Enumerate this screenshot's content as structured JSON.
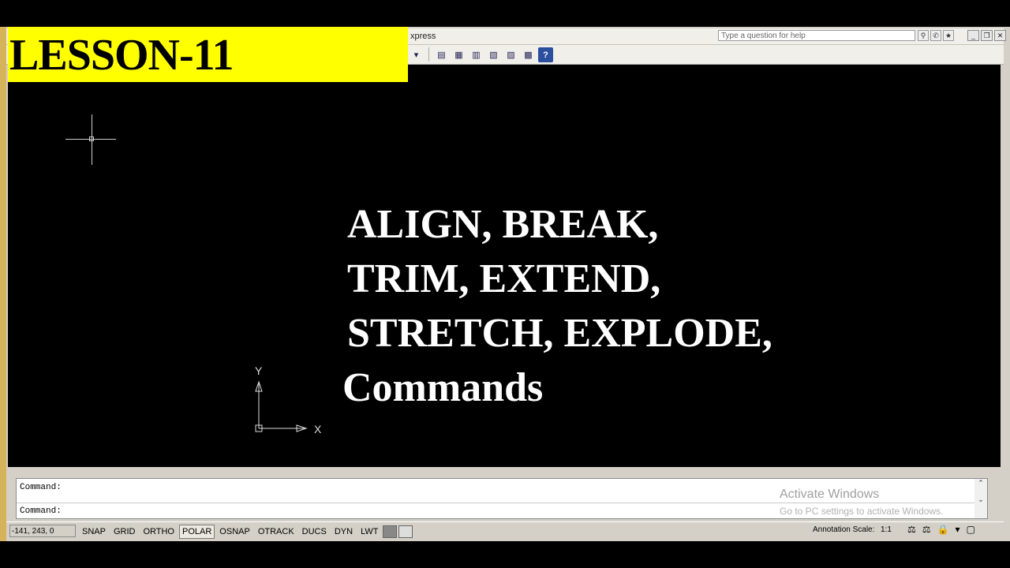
{
  "overlay": {
    "lesson_label": "LESSON-11",
    "title_lines": [
      "ALIGN, BREAK,",
      "TRIM, EXTEND,",
      "STRETCH, EXPLODE,"
    ],
    "subtitle": "Commands"
  },
  "menubar": {
    "fragment": "xpress",
    "help_placeholder": "Type a question for help"
  },
  "toolbar": {
    "icons": [
      "properties-icon",
      "design-center-icon",
      "tool-palettes-icon",
      "sheet-set-icon",
      "markup-icon",
      "quickcalc-icon",
      "help-icon"
    ]
  },
  "canvas": {
    "ucs_x_label": "X",
    "ucs_y_label": "Y"
  },
  "command_line": {
    "line1": "Command:",
    "line2": "Command:"
  },
  "watermark": {
    "title": "Activate Windows",
    "subtitle": "Go to PC settings to activate Windows."
  },
  "statusbar": {
    "coordinates": "-141, 243, 0",
    "toggles": [
      "SNAP",
      "GRID",
      "ORTHO",
      "POLAR",
      "OSNAP",
      "OTRACK",
      "DUCS",
      "DYN",
      "LWT"
    ],
    "active_toggle": "POLAR",
    "annotation_label": "Annotation Scale:",
    "annotation_value": "1:1"
  },
  "colors": {
    "highlight": "#ffff00",
    "canvas": "#000000",
    "chrome": "#d4d0c8"
  }
}
